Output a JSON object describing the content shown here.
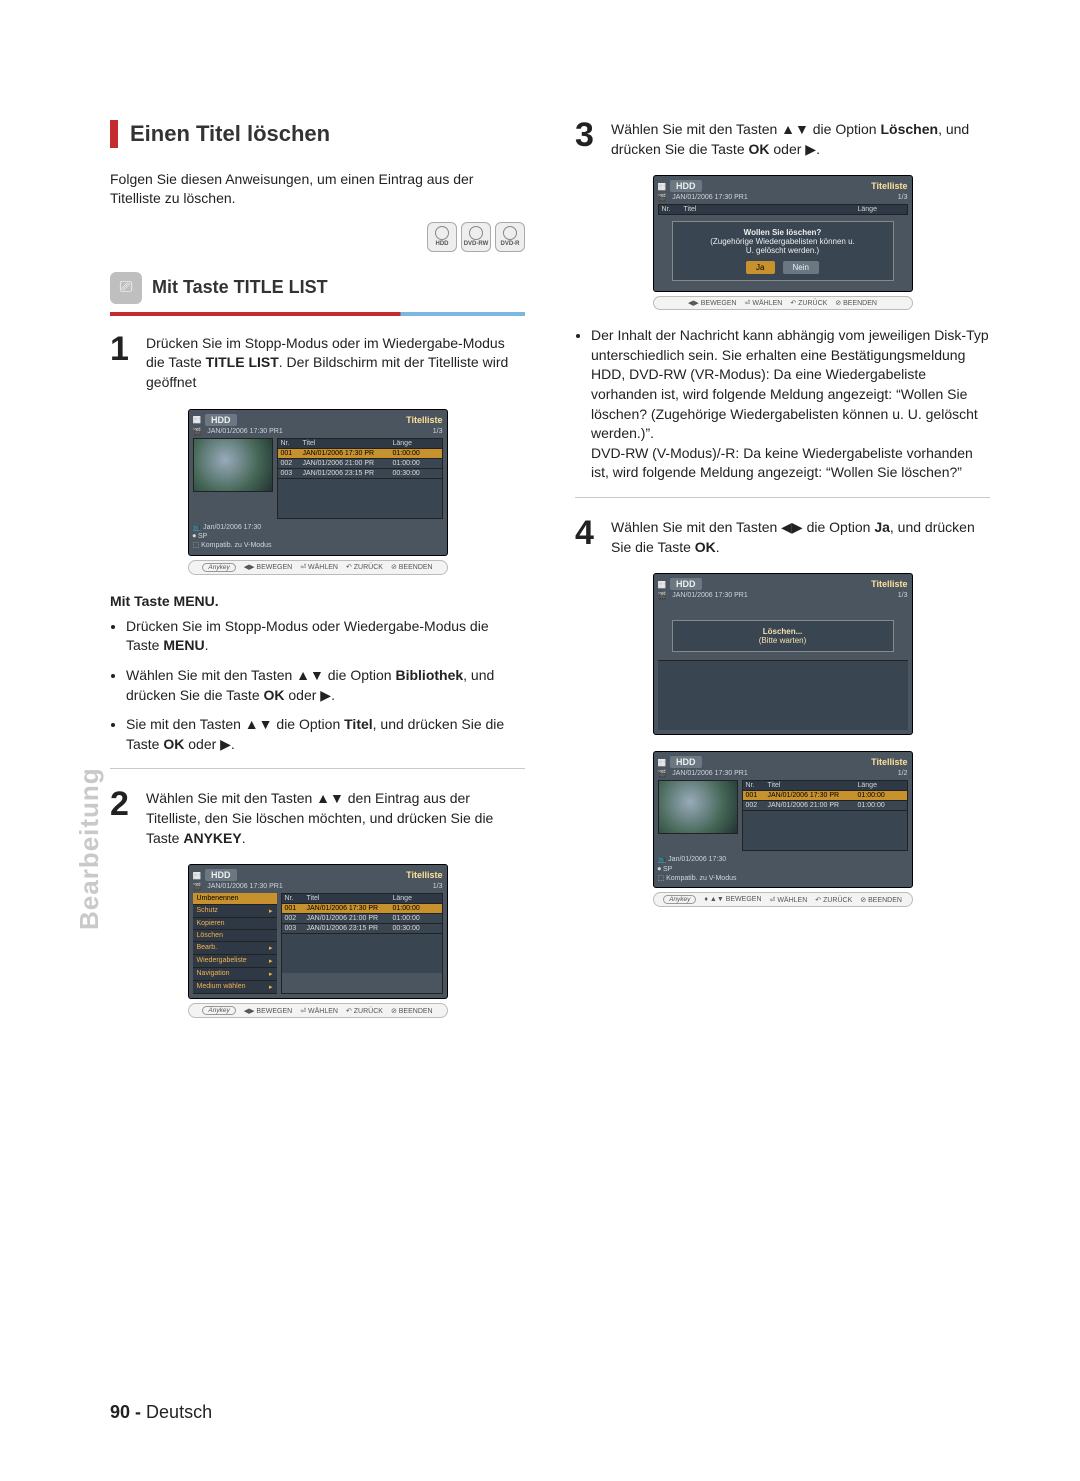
{
  "section": {
    "title": "Einen Titel löschen"
  },
  "intro": "Folgen Sie diesen Anweisungen, um einen Eintrag aus der Titelliste zu löschen.",
  "discs": [
    "HDD",
    "DVD-RW",
    "DVD-R"
  ],
  "sub1": {
    "title": "Mit Taste TITLE LIST"
  },
  "step1": {
    "l1": "Drücken Sie im Stopp-Modus oder im Wiedergabe-Modus die Taste ",
    "b1": "TITLE LIST",
    "l2": ". Der Bildschirm mit der Titelliste wird geöffnet"
  },
  "menu_head": "Mit Taste MENU.",
  "menu_b1a": "Drücken Sie im Stopp-Modus oder Wiedergabe-Modus die Taste ",
  "menu_b1b": "MENU",
  "menu_b1c": ".",
  "menu_b2a": "Wählen Sie mit den Tasten ▲▼ die Option ",
  "menu_b2b": "Bibliothek",
  "menu_b2c": ", und drücken Sie die Taste ",
  "menu_b2d": "OK",
  "menu_b2e": " oder ▶.",
  "menu_b3a": "Sie mit den Tasten ▲▼ die Option ",
  "menu_b3b": "Titel",
  "menu_b3c": ", und drücken Sie die Taste ",
  "menu_b3d": "OK",
  "menu_b3e": " oder ▶.",
  "step2": {
    "l1": "Wählen Sie mit den Tasten ▲▼ den Eintrag aus der Titelliste, den Sie löschen möchten, und drücken Sie die Taste ",
    "b1": "ANYKEY",
    "l2": "."
  },
  "step3": {
    "l1": "Wählen Sie mit den Tasten ▲▼ die Option ",
    "b1": "Löschen",
    "l2": ", und drücken Sie die Taste ",
    "b2": "OK",
    "l3": " oder ▶."
  },
  "note3": {
    "p1": "Der Inhalt der Nachricht kann abhängig vom jeweiligen Disk-Typ unterschiedlich sein. Sie erhalten eine Bestätigungsmeldung HDD, DVD-RW (VR-Modus): Da eine Wiedergabeliste vorhanden ist, wird folgende Meldung angezeigt: “Wollen Sie löschen? (Zugehörige Wiedergabelisten können u. U. gelöscht werden.)”.",
    "p2": "DVD-RW (V-Modus)/-R: Da keine Wiedergabeliste vorhanden ist, wird folgende Meldung angezeigt: “Wollen Sie löschen?”"
  },
  "step4": {
    "l1": "Wählen Sie mit den Tasten ◀▶ die Option ",
    "b1": "Ja",
    "l2": ", und drücken Sie die Taste ",
    "b2": "OK",
    "l3": "."
  },
  "side_tab": "Bearbeitung",
  "footer": {
    "page": "90 -",
    "lang": "Deutsch"
  },
  "osd_common": {
    "device": "HDD",
    "screen_title": "Titelliste",
    "date": "JAN/01/2006 17:30 PR1",
    "page13": "1/3",
    "page12": "1/2",
    "cols": {
      "nr": "Nr.",
      "titel": "Titel",
      "laenge": "Länge"
    },
    "rows3": [
      {
        "nr": "001",
        "t": "JAN/01/2006 17:30 PR",
        "l": "01:00:00"
      },
      {
        "nr": "002",
        "t": "JAN/01/2006 21:00 PR",
        "l": "01:00:00"
      },
      {
        "nr": "003",
        "t": "JAN/01/2006 23:15 PR",
        "l": "00:30:00"
      }
    ],
    "rows2": [
      {
        "nr": "001",
        "t": "JAN/01/2006 17:30 PR",
        "l": "01:00:00"
      },
      {
        "nr": "002",
        "t": "JAN/01/2006 21:00 PR",
        "l": "01:00:00"
      }
    ],
    "meta": {
      "l1": "Jan/01/2006 17:30",
      "l2": "SP",
      "l3": "Kompatib. zu V-Modus"
    },
    "ctx": [
      "Umbenennen",
      "Schutz",
      "Kopieren",
      "Löschen",
      "Bearb.",
      "Wiedergabeliste",
      "Navigation",
      "Medium wählen"
    ],
    "modal": {
      "l1": "Wollen Sie löschen?",
      "l2": "(Zugehörige Wiedergabelisten können u.",
      "l3": "U. gelöscht werden.)",
      "yes": "Ja",
      "no": "Nein"
    },
    "progress": {
      "l1": "Löschen...",
      "l2": "(Bitte warten)"
    },
    "bar": {
      "anykey": "Anykey",
      "move_lr": "◀▶ BEWEGEN",
      "move_ud": "▲▼ BEWEGEN",
      "select": "WÄHLEN",
      "back": "ZURÜCK",
      "exit": "BEENDEN"
    }
  }
}
